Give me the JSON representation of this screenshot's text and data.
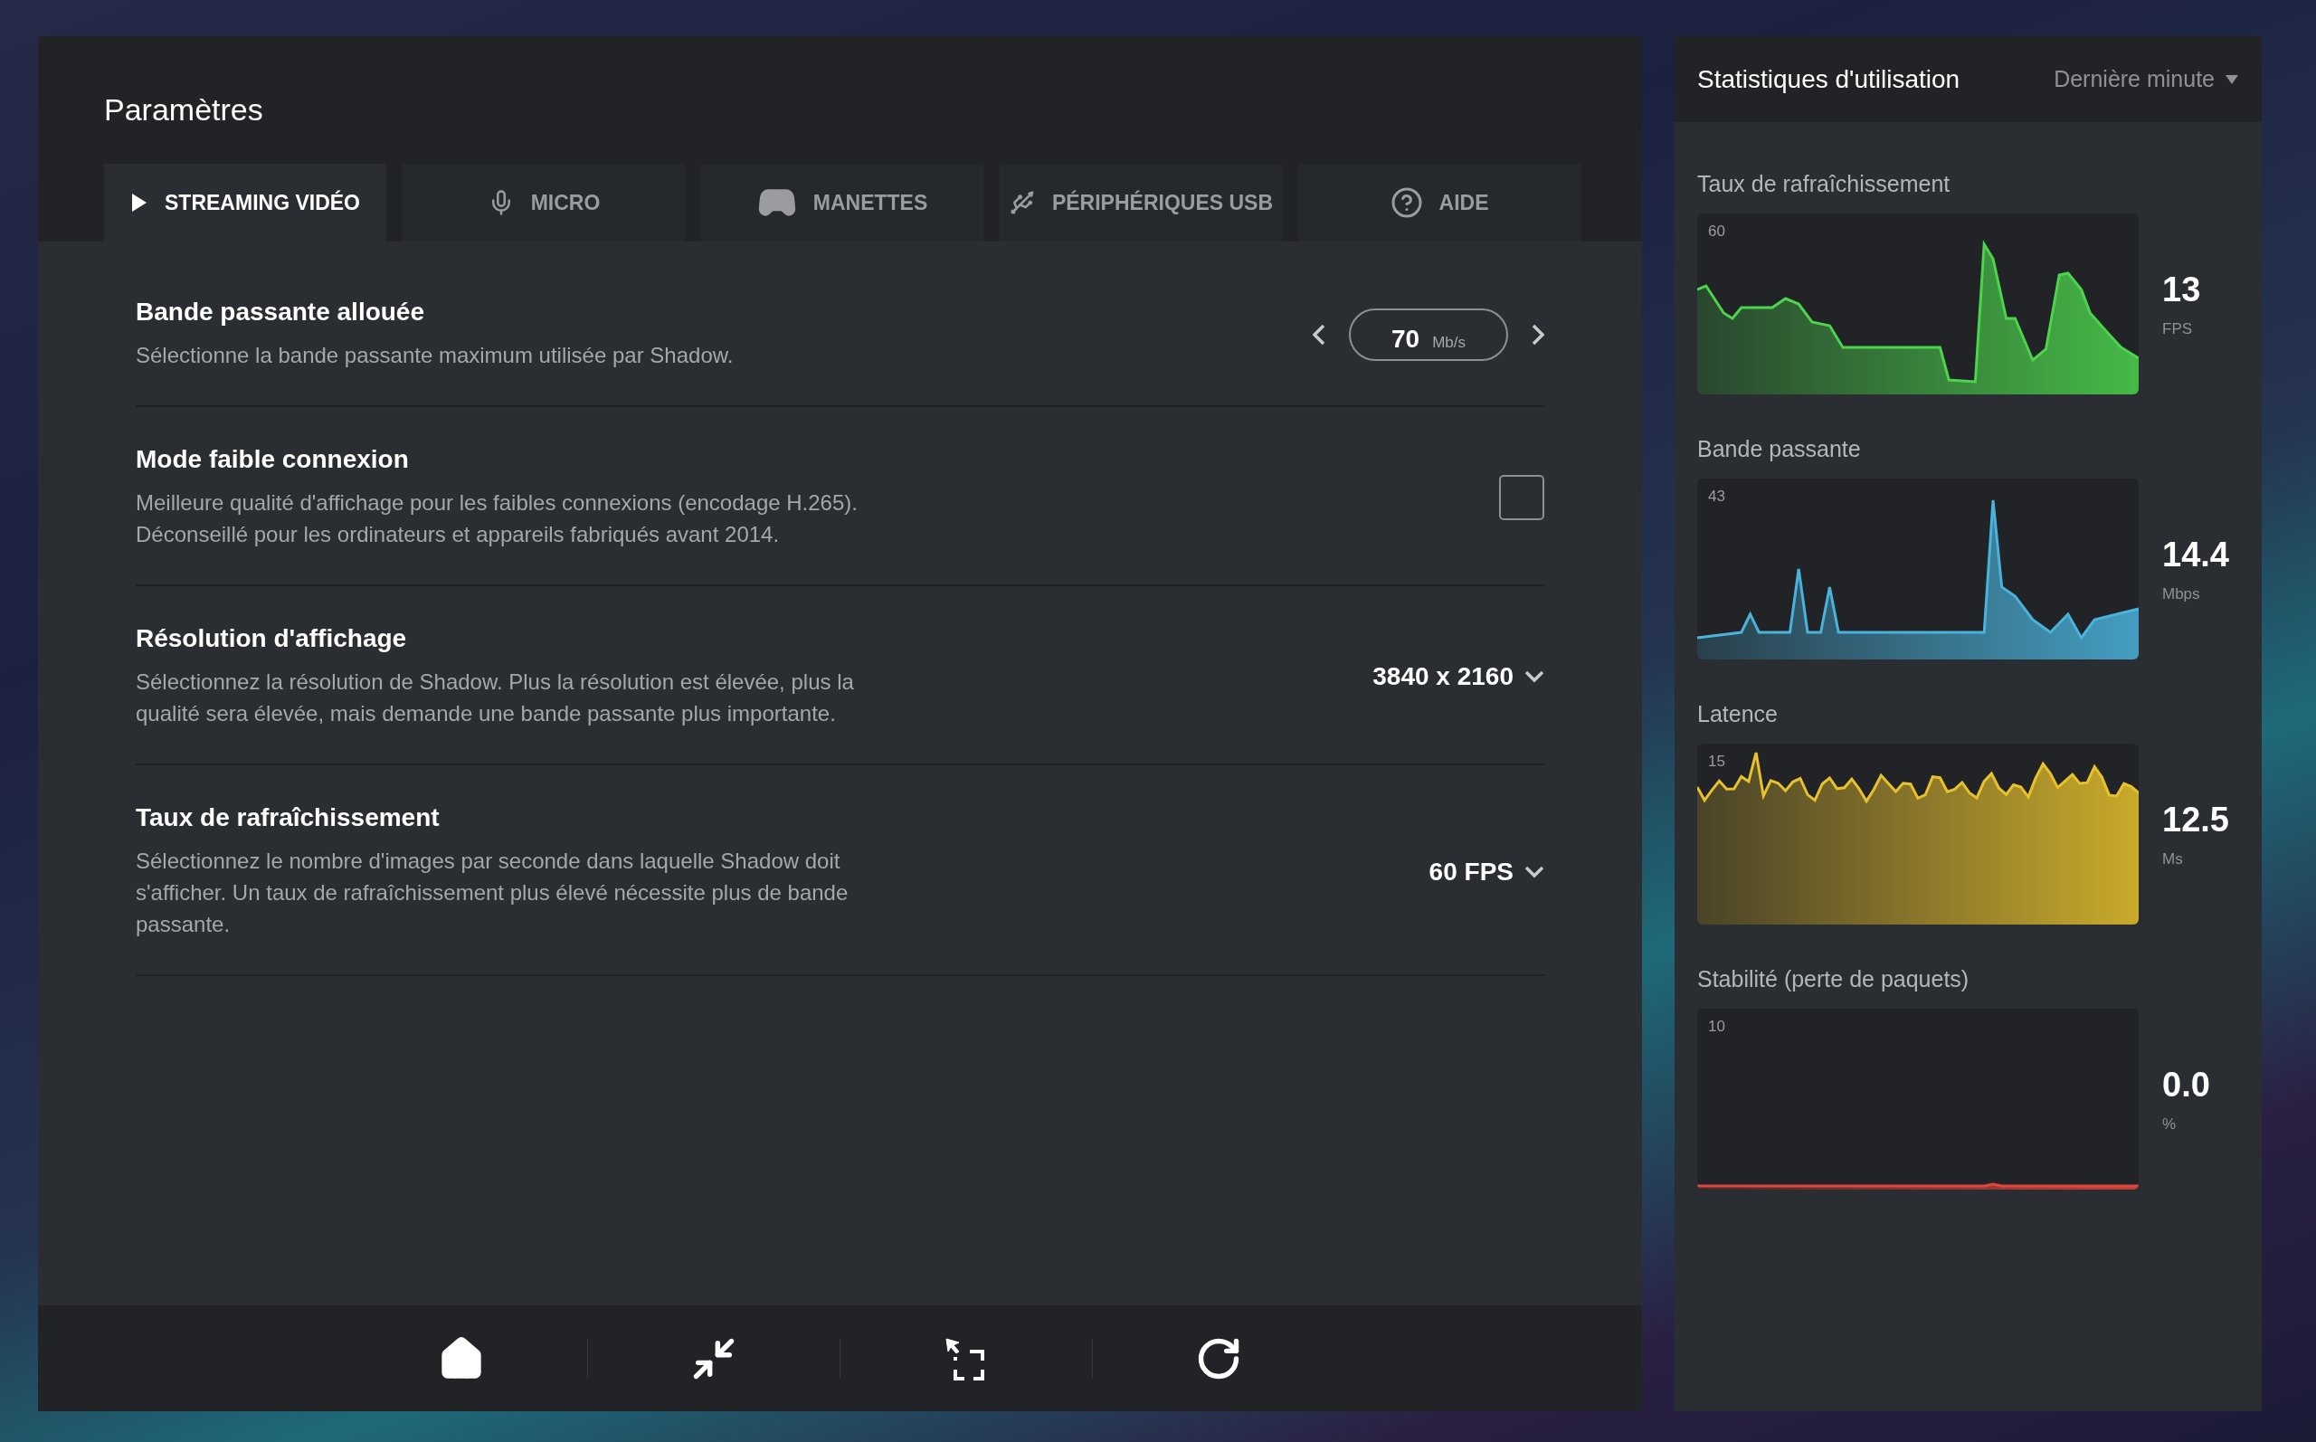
{
  "settings": {
    "title": "Paramètres",
    "tabs": [
      {
        "label": "STREAMING VIDÉO",
        "kind": "play",
        "selected": true
      },
      {
        "label": "MICRO",
        "kind": "mic",
        "selected": false
      },
      {
        "label": "MANETTES",
        "kind": "gamepad",
        "selected": false
      },
      {
        "label": "PÉRIPHÉRIQUES USB",
        "kind": "usb",
        "selected": false
      },
      {
        "label": "AIDE",
        "kind": "help",
        "selected": false
      }
    ],
    "rows": [
      {
        "kind": "stepper",
        "title": "Bande passante allouée",
        "description": "Sélectionne la bande passante maximum utilisée par Shadow.",
        "value": "70",
        "unit": "Mb/s"
      },
      {
        "kind": "checkbox",
        "title": "Mode faible connexion",
        "description": "Meilleure qualité d'affichage pour les faibles connexions (encodage H.265).\nDéconseillé pour les ordinateurs et appareils fabriqués avant 2014.",
        "checked": false
      },
      {
        "kind": "dropdown",
        "title": "Résolution d'affichage",
        "description": "Sélectionnez la résolution de Shadow. Plus la résolution est élevée, plus la\nqualité sera élevée, mais demande une bande passante plus importante.",
        "value": "3840 x 2160"
      },
      {
        "kind": "dropdown",
        "title": "Taux de rafraîchissement",
        "description": "Sélectionnez le nombre d'images par seconde dans laquelle Shadow doit\ns'afficher. Un taux de rafraîchissement plus élevé nécessite plus de bande\npassante.",
        "value": "60 FPS"
      }
    ],
    "toolbar": [
      {
        "kind": "home"
      },
      {
        "kind": "minimize"
      },
      {
        "kind": "frame"
      },
      {
        "kind": "reload"
      }
    ]
  },
  "stats": {
    "title": "Statistiques d'utilisation",
    "period": "Dernière minute",
    "graphs": [
      {
        "label": "Taux de rafraîchissement",
        "max_label": "60",
        "value": "13",
        "unit": "FPS",
        "color": "#4cd44c"
      },
      {
        "label": "Bande passante",
        "max_label": "43",
        "value": "14.4",
        "unit": "Mbps",
        "color": "#4ab3dc"
      },
      {
        "label": "Latence",
        "max_label": "15",
        "value": "12.5",
        "unit": "Ms",
        "color": "#e8c22c"
      },
      {
        "label": "Stabilité (perte de paquets)",
        "max_label": "10",
        "value": "0.0",
        "unit": "%",
        "color": "#e0463c"
      }
    ]
  }
}
